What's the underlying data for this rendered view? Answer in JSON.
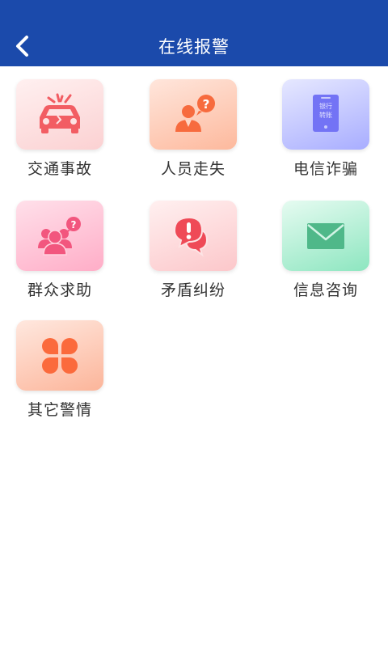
{
  "header": {
    "title": "在线报警",
    "back_icon": "chevron-left-icon",
    "bar_color": "#1b4aab"
  },
  "tiles": [
    {
      "label": "交通事故",
      "icon": "car-crash-icon",
      "color": "#f25d63"
    },
    {
      "label": "人员走失",
      "icon": "missing-person-icon",
      "color": "#f76b3e"
    },
    {
      "label": "电信诈骗",
      "icon": "phone-icon",
      "color": "#7373f5",
      "icon_text": [
        "银行",
        "转账"
      ]
    },
    {
      "label": "群众求助",
      "icon": "people-help-icon",
      "color": "#f2567e"
    },
    {
      "label": "矛盾纠纷",
      "icon": "dispute-chat-icon",
      "color": "#ef4a57"
    },
    {
      "label": "信息咨询",
      "icon": "envelope-icon",
      "color": "#4fb889"
    },
    {
      "label": "其它警情",
      "icon": "clover-icon",
      "color": "#fb6a3c"
    }
  ]
}
